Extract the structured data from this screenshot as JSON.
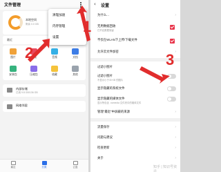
{
  "left_screen": {
    "title": "文件管理",
    "storage": {
      "label": "本地空间",
      "sub": "剩余 0.0 GB"
    },
    "recent_label": "最近",
    "categories": [
      {
        "label": "图片"
      },
      {
        "label": "视频"
      },
      {
        "label": "音频"
      },
      {
        "label": "文档"
      },
      {
        "label": "安装包"
      },
      {
        "label": "压缩包"
      },
      {
        "label": "收藏"
      },
      {
        "label": "其他"
      }
    ],
    "internal_storage": {
      "title": "内部存储",
      "sub": "已用 9.8 GB/136 GB"
    },
    "network_neighbor": {
      "title": "网络邻居"
    },
    "popup_menu": [
      "清理加速",
      "内存管理",
      "设置"
    ],
    "bottom_nav": [
      {
        "label": "最近"
      },
      {
        "label": "分类"
      },
      {
        "label": "云盘"
      }
    ]
  },
  "right_screen": {
    "back_icon": "‹",
    "title": "设置",
    "rows": {
      "user": {
        "title": "为什么..."
      },
      "auto_delete": {
        "title": "无用数据回收",
        "sub": "已开启数据保留"
      },
      "sync": {
        "title": "不仅在WLAN下上传/下载文件"
      },
      "cloud": {
        "title": "允许云文件加密"
      },
      "manage": {
        "title": "过滤小图片"
      },
      "filter_small": {
        "title": "过滤小图片",
        "sub": "不显示小于30 KB 的图片"
      },
      "hidden_sys": {
        "title": "显示隐藏的系统文件"
      },
      "hidden_media": {
        "title": "显示隐藏的媒体文件",
        "sub": "显示所包含 .nomedia 文件夹中的媒体文件"
      },
      "manage_recent": {
        "title": "管理\"最近\"中屏蔽的来源"
      },
      "flow": {
        "title": "流量保存"
      },
      "feedback": {
        "title": "问题与建议"
      },
      "version": {
        "title": "检查更新"
      },
      "about": {
        "title": "关于"
      }
    }
  },
  "annotations": [
    "1",
    "2",
    "3"
  ],
  "watermark": "知乎 | 知识号资讯",
  "colors": {
    "accent": "#2a6ee8",
    "arrow": "#e12d2d",
    "ring": "#f39c2a"
  }
}
